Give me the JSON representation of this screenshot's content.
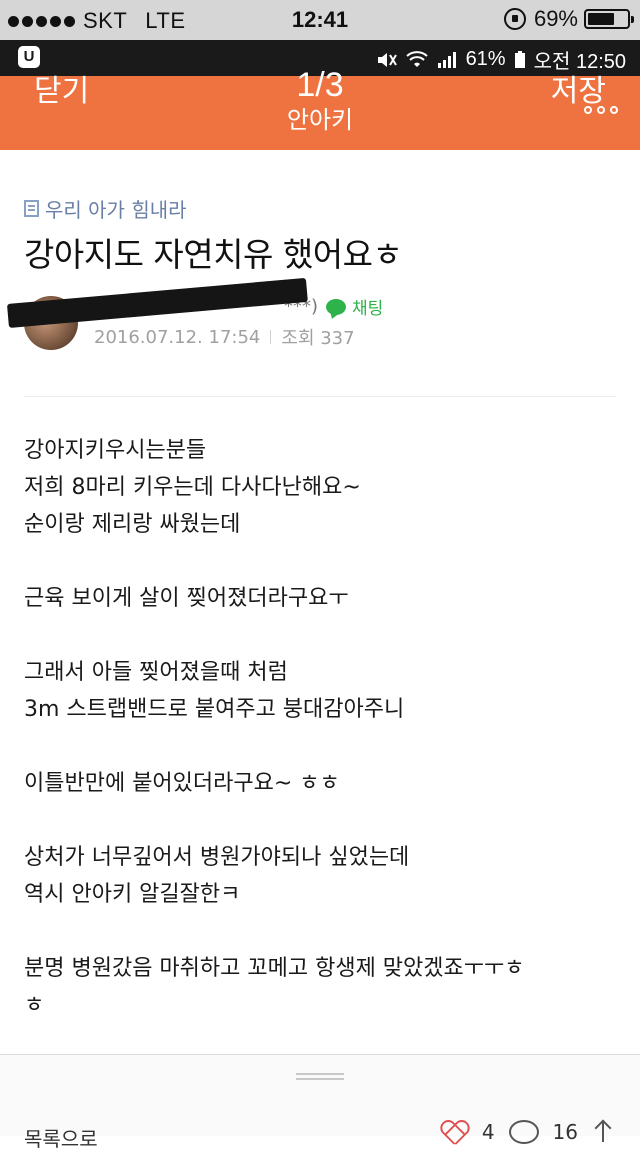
{
  "ios_status": {
    "carrier": "SKT",
    "network": "LTE",
    "time": "12:41",
    "battery": "69%",
    "battery_level": 0.69
  },
  "android_status": {
    "signal_text": "61%",
    "time": "오전 12:50"
  },
  "appbar": {
    "close_label": "닫기",
    "page_indicator": "1/3",
    "cafe_name": "안아키",
    "save_label": "저장",
    "accent_color": "#ef7340"
  },
  "post": {
    "board_name": "우리 아가 힘내라",
    "title": "강아지도 자연치유 했어요ㅎ",
    "author_suffix": "***)",
    "chat_label": "채팅",
    "date": "2016.07.12. 17:54",
    "views": "조회 337",
    "paragraphs": [
      [
        "강아지키우시는분들",
        "저희 8마리 키우는데 다사다난해요~",
        "순이랑 제리랑 싸웠는데"
      ],
      [
        "근육 보이게 살이 찢어졌더라구요ㅜ"
      ],
      [
        "그래서 아들 찢어졌을때 처럼",
        "3m 스트랩밴드로 붙여주고 붕대감아주니"
      ],
      [
        "이틀반만에 붙어있더라구요~ ㅎㅎ"
      ],
      [
        "상처가 너무깊어서 병원가야되나 싶었는데",
        "역시 안아키 알길잘한ㅋ"
      ],
      [
        "분명 병원갔음 마취하고 꼬메고 항생제 맞았겠죠ㅜㅜㅎ",
        "ㅎ"
      ]
    ]
  },
  "bottom": {
    "list_label": "목록으로",
    "like_count": "4",
    "comment_count": "16"
  }
}
